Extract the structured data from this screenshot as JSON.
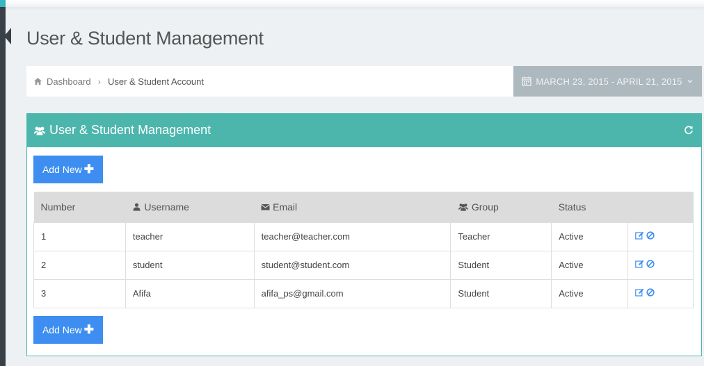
{
  "page": {
    "title": "User & Student Management"
  },
  "breadcrumb": {
    "home_label": "Dashboard",
    "separator": "›",
    "current_label": "User & Student Account"
  },
  "daterange": {
    "label": "MARCH 23, 2015 - APRIL 21, 2015"
  },
  "panel": {
    "title": "User & Student Management",
    "header_color": "#4db6ac"
  },
  "buttons": {
    "add_new_label": "Add New",
    "add_new_color": "#3d8ef0"
  },
  "table": {
    "columns": [
      "Number",
      "Username",
      "Email",
      "Group",
      "Status"
    ],
    "rows": [
      {
        "number": "1",
        "username": "teacher",
        "email": "teacher@teacher.com",
        "group": "Teacher",
        "status": "Active"
      },
      {
        "number": "2",
        "username": "student",
        "email": "student@student.com",
        "group": "Student",
        "status": "Active"
      },
      {
        "number": "3",
        "username": "Afifa",
        "email": "afifa_ps@gmail.com",
        "group": "Student",
        "status": "Active"
      }
    ]
  },
  "icons": {
    "home": "home-icon",
    "calendar": "calendar-icon",
    "users": "users-icon",
    "refresh": "refresh-icon",
    "user": "user-icon",
    "envelope": "envelope-icon",
    "edit": "edit-icon",
    "ban": "ban-icon"
  }
}
